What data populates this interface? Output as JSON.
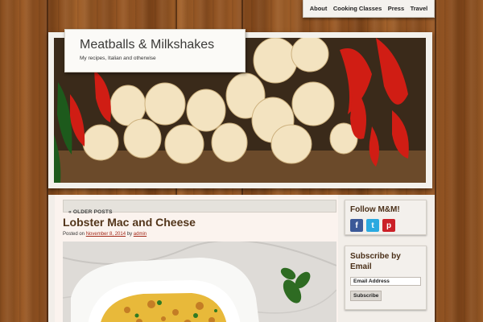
{
  "nav": {
    "items": [
      "About",
      "Cooking Classes",
      "Press",
      "Travel"
    ]
  },
  "site": {
    "title": "Meatballs & Milkshakes",
    "tagline": "My recipes, Italian and otherwise"
  },
  "pagination": {
    "older_label": "« OLDER POSTS"
  },
  "post": {
    "title": "Lobster Mac and Cheese",
    "meta_prefix": "Posted on",
    "date": "November 8, 2014",
    "by": "by",
    "author": "admin"
  },
  "sidebar": {
    "follow": {
      "title": "Follow M&M!",
      "icons": [
        {
          "name": "facebook-icon",
          "glyph": "f",
          "color": "#3b5998"
        },
        {
          "name": "twitter-icon",
          "glyph": "t",
          "color": "#2aa9e0"
        },
        {
          "name": "pinterest-icon",
          "glyph": "p",
          "color": "#cb2027"
        }
      ]
    },
    "subscribe": {
      "title": "Subscribe by Email",
      "input_value": "Email Address",
      "button_label": "Subscribe"
    }
  },
  "colors": {
    "wood": "#8a4e1f",
    "post_title": "#52351a",
    "link": "#a32a1a"
  }
}
